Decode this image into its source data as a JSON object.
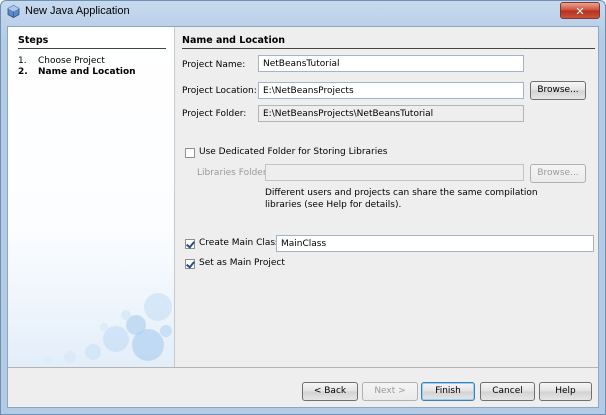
{
  "window": {
    "title": "New Java Application",
    "close_glyph": "✕"
  },
  "steps": {
    "heading": "Steps",
    "items": [
      {
        "num": "1.",
        "label": "Choose Project",
        "active": false
      },
      {
        "num": "2.",
        "label": "Name and Location",
        "active": true
      }
    ]
  },
  "form": {
    "heading": "Name and Location",
    "project_name_label": "Project Name:",
    "project_name_value": "NetBeansTutorial",
    "project_location_label": "Project Location:",
    "project_location_value": "E:\\NetBeansProjects",
    "browse_label": "Browse...",
    "project_folder_label": "Project Folder:",
    "project_folder_value": "E:\\NetBeansProjects\\NetBeansTutorial",
    "dedicated_folder_label": "Use Dedicated Folder for Storing Libraries",
    "dedicated_folder_checked": false,
    "libraries_folder_label": "Libraries Folder:",
    "libraries_folder_value": "",
    "libraries_browse_label": "Browse...",
    "hint_line1": "Different users and projects can share the same compilation",
    "hint_line2": "libraries (see Help for details).",
    "create_main_class_label": "Create Main Class",
    "create_main_class_checked": true,
    "main_class_value": "MainClass",
    "set_main_project_label": "Set as Main Project",
    "set_main_project_checked": true
  },
  "buttons": {
    "back": "< Back",
    "next": "Next >",
    "finish": "Finish",
    "cancel": "Cancel",
    "help": "Help"
  }
}
